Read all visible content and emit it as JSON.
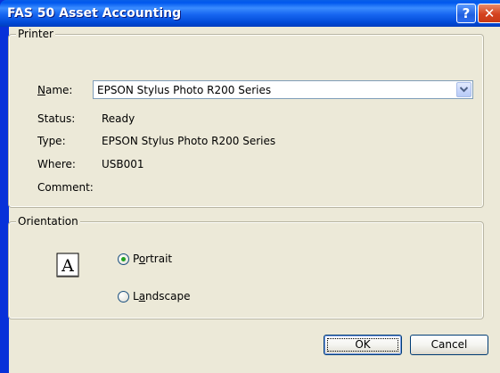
{
  "window": {
    "title": "FAS 50 Asset Accounting",
    "help_label": "?",
    "close_label": "✕"
  },
  "printer": {
    "group_label": "Printer",
    "name_label_u": "N",
    "name_label_rest": "ame:",
    "name_value": "EPSON Stylus Photo R200 Series",
    "status_label": "Status:",
    "status_value": "Ready",
    "type_label": "Type:",
    "type_value": "EPSON Stylus Photo R200 Series",
    "where_label": "Where:",
    "where_value": "USB001",
    "comment_label": "Comment:",
    "comment_value": ""
  },
  "orientation": {
    "group_label": "Orientation",
    "icon_letter": "A",
    "portrait_pre": "P",
    "portrait_u": "o",
    "portrait_post": "rtrait",
    "portrait_selected": true,
    "landscape_pre": "L",
    "landscape_u": "a",
    "landscape_post": "ndscape",
    "landscape_selected": false
  },
  "buttons": {
    "ok_label": "OK",
    "cancel_label": "Cancel"
  },
  "colors": {
    "titlebar": "#0058ee",
    "dialog_bg": "#ece9d8",
    "radio_dot": "#21a121"
  }
}
